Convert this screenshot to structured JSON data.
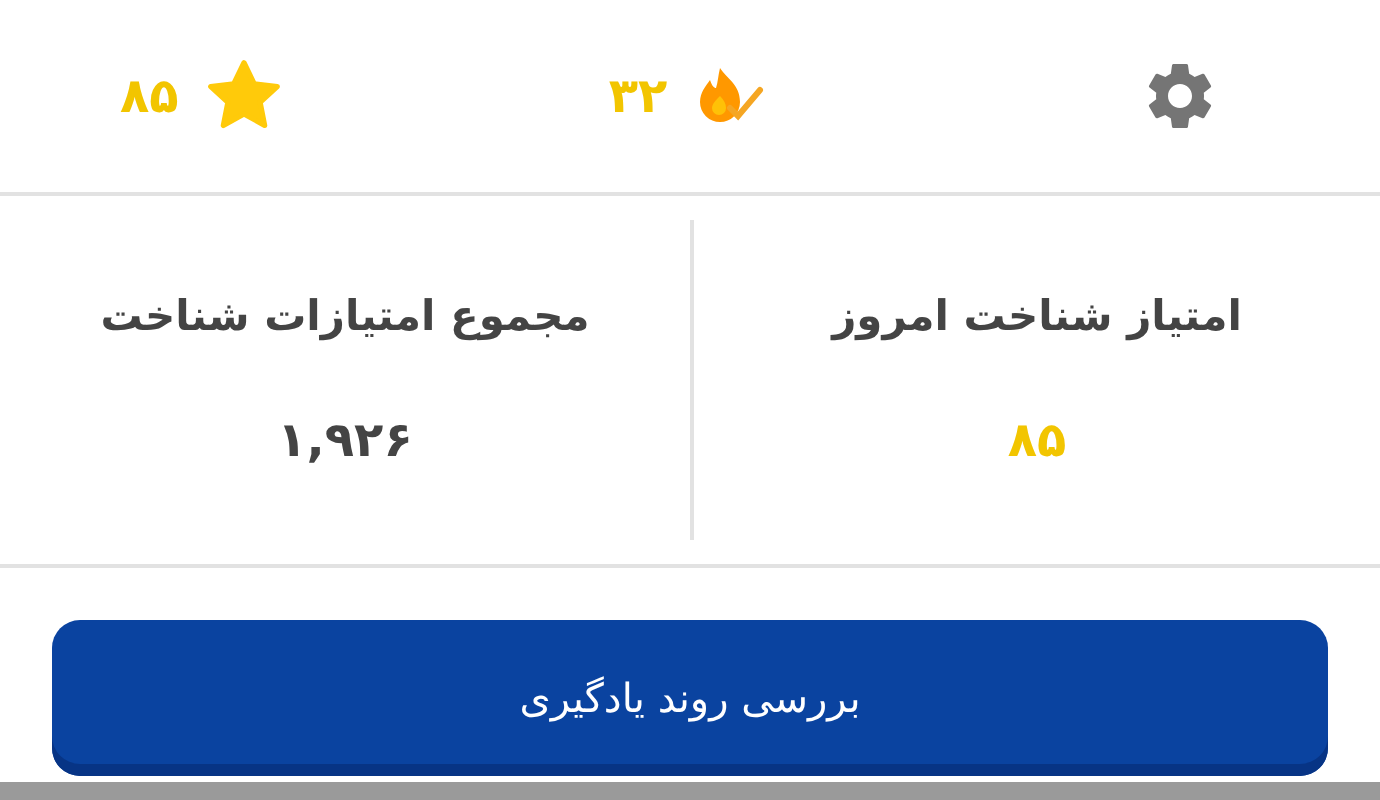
{
  "top_bar": {
    "streak": "۳۲",
    "stars": "۸۵"
  },
  "stats": [
    {
      "label": "امتیاز شناخت امروز",
      "value": "۸۵",
      "highlighted": true
    },
    {
      "label": "مجموع امتیازات شناخت",
      "value": "۱,۹۲۶",
      "highlighted": false
    }
  ],
  "button": {
    "label": "بررسی روند یادگیری"
  }
}
